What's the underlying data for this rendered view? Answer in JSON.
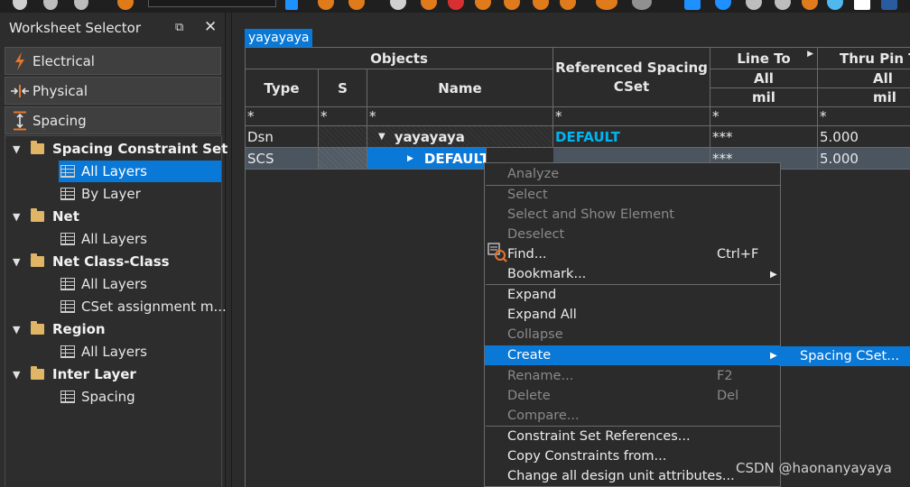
{
  "panel": {
    "title": "Worksheet Selector",
    "float_glyph": "⧉",
    "close_glyph": "✕",
    "tabs": [
      {
        "label": "Electrical",
        "icon": "lightning-icon"
      },
      {
        "label": "Physical",
        "icon": "physical-arrows-icon"
      },
      {
        "label": "Spacing",
        "icon": "spacing-icon"
      }
    ]
  },
  "tree": {
    "groups": [
      {
        "label": "Spacing Constraint Set",
        "children": [
          "All Layers",
          "By Layer"
        ]
      },
      {
        "label": "Net",
        "children": [
          "All Layers"
        ]
      },
      {
        "label": "Net Class-Class",
        "children": [
          "All Layers",
          "CSet assignment m..."
        ]
      },
      {
        "label": "Region",
        "children": [
          "All Layers"
        ]
      },
      {
        "label": "Inter Layer",
        "children": [
          "Spacing"
        ]
      }
    ],
    "selected": "Spacing Constraint Set / All Layers"
  },
  "sheet": {
    "tab_label": "yayayaya",
    "headers": {
      "objects": "Objects",
      "type": "Type",
      "s": "S",
      "name": "Name",
      "ref_spacing": "Referenced Spacing",
      "cset": "CSet",
      "line_to": "Line To",
      "thru_pin": "Thru Pin To",
      "all": "All",
      "unit": "mil"
    },
    "filter_row": "*",
    "rows": [
      {
        "type": "Dsn",
        "name": "yayayaya",
        "ref": "DEFAULT",
        "line_to": "***",
        "thru_pin": "5.000"
      },
      {
        "type": "SCS",
        "name": "DEFAULT",
        "ref": "",
        "line_to": "***",
        "thru_pin": "5.000"
      }
    ]
  },
  "context_menu": {
    "items": [
      {
        "label": "Analyze",
        "enabled": false
      },
      {
        "label": "Select",
        "enabled": false
      },
      {
        "label": "Select and Show Element",
        "enabled": false
      },
      {
        "label": "Deselect",
        "enabled": false
      },
      {
        "label": "Find...",
        "shortcut": "Ctrl+F",
        "enabled": true
      },
      {
        "label": "Bookmark...",
        "submenu": true,
        "enabled": true
      },
      {
        "label": "Expand",
        "enabled": true
      },
      {
        "label": "Expand All",
        "enabled": true
      },
      {
        "label": "Collapse",
        "enabled": false
      },
      {
        "label": "Create",
        "submenu": true,
        "enabled": true,
        "highlighted": true
      },
      {
        "label": "Rename...",
        "shortcut": "F2",
        "enabled": false
      },
      {
        "label": "Delete",
        "shortcut": "Del",
        "enabled": false
      },
      {
        "label": "Compare...",
        "enabled": false
      },
      {
        "label": "Constraint Set References...",
        "enabled": true
      },
      {
        "label": "Copy Constraints from...",
        "enabled": true
      },
      {
        "label": "Change all design unit attributes...",
        "enabled": true
      }
    ],
    "submenu_item": "Spacing CSet..."
  },
  "watermark": "CSDN @haonanyayaya",
  "colors": {
    "accent": "#0a78d7",
    "cyan_text": "#00b4f0",
    "folder": "#e0b565",
    "bg": "#2b2b2b"
  }
}
